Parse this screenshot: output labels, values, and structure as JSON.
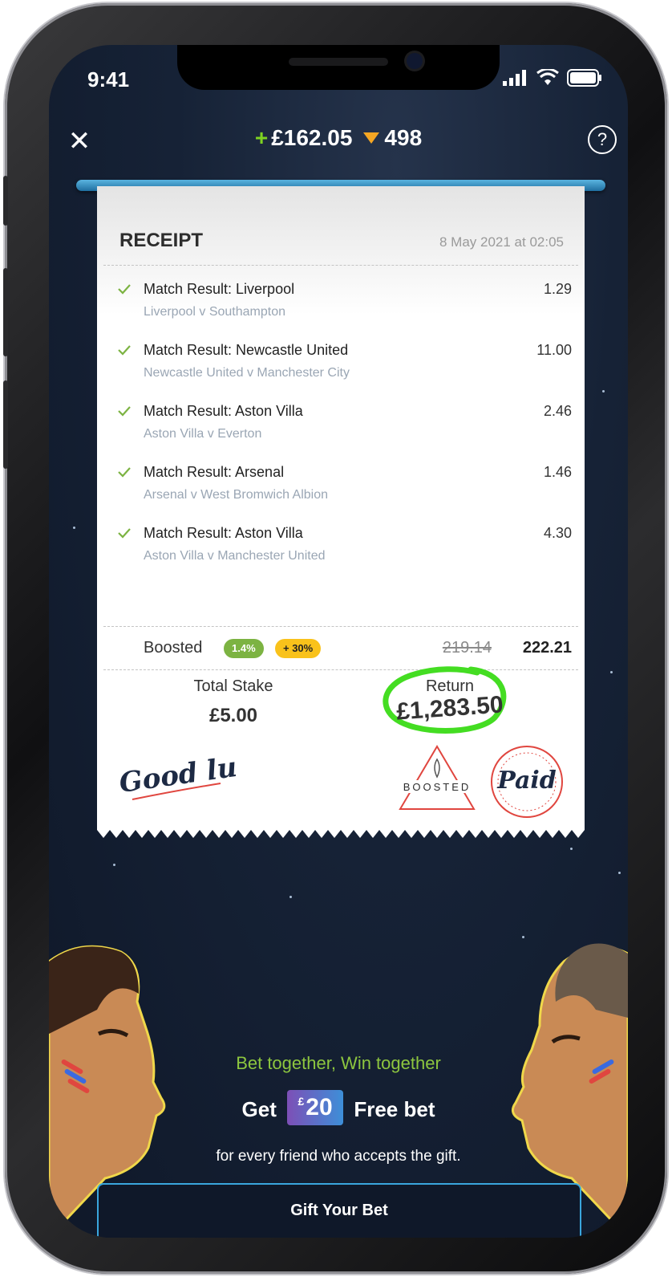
{
  "status_bar": {
    "time": "9:41"
  },
  "header": {
    "balance_change": "£162.05",
    "gems": "498",
    "help_label": "?"
  },
  "receipt": {
    "title": "RECEIPT",
    "date": "8 May 2021 at 02:05",
    "selections": [
      {
        "name": "Match Result: Liverpool",
        "match": "Liverpool v Southampton",
        "odds": "1.29"
      },
      {
        "name": "Match Result: Newcastle United",
        "match": "Newcastle United v Manchester City",
        "odds": "11.00"
      },
      {
        "name": "Match Result: Aston Villa",
        "match": "Aston Villa v Everton",
        "odds": "2.46"
      },
      {
        "name": "Match Result: Arsenal",
        "match": "Arsenal v West Bromwich Albion",
        "odds": "1.46"
      },
      {
        "name": "Match Result: Aston Villa",
        "match": "Aston Villa v Manchester United",
        "odds": "4.30"
      }
    ],
    "boost": {
      "label": "Boosted",
      "badge_percent": "1.4%",
      "badge_bonus": "+ 30%",
      "old_odds": "219.14",
      "new_odds": "222.21"
    },
    "total_stake_label": "Total Stake",
    "total_stake": "£5.00",
    "return_label": "Return",
    "return_value": "£1,283.50",
    "stamps": {
      "good_luck": "Good luck",
      "boosted": "BOOSTED",
      "paid": "Paid"
    }
  },
  "promo": {
    "tagline": "Bet together, Win together",
    "offer_prefix": "Get",
    "offer_currency": "£",
    "offer_amount": "20",
    "offer_suffix": "Free bet",
    "sub_text": "for every friend who accepts the gift.",
    "cta": "Gift Your Bet"
  },
  "colors": {
    "accent_green": "#7ed321",
    "gem": "#f5a623",
    "cta_border": "#3aa6dd",
    "tagline": "#8dc63f",
    "circle": "#44dd22"
  }
}
